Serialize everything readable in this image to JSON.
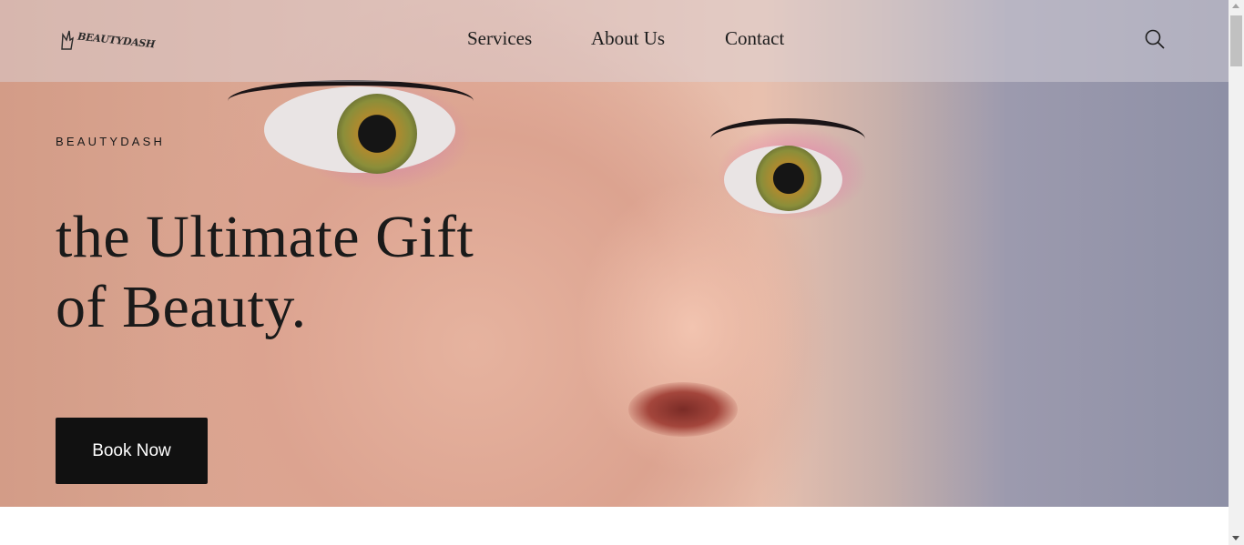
{
  "brand": {
    "logo_text": "BEAUTYDASH",
    "logo_icon": "fox-logo-icon"
  },
  "nav": {
    "items": [
      {
        "label": "Services"
      },
      {
        "label": "About Us"
      },
      {
        "label": "Contact"
      }
    ],
    "search_icon": "search-icon"
  },
  "hero": {
    "eyebrow": "BEAUTYDASH",
    "headline_line1": "the Ultimate Gift",
    "headline_line2": "of Beauty.",
    "cta_label": "Book Now"
  },
  "colors": {
    "cta_background": "#111111",
    "cta_text": "#ffffff",
    "text_dark": "#1a1a1a"
  }
}
